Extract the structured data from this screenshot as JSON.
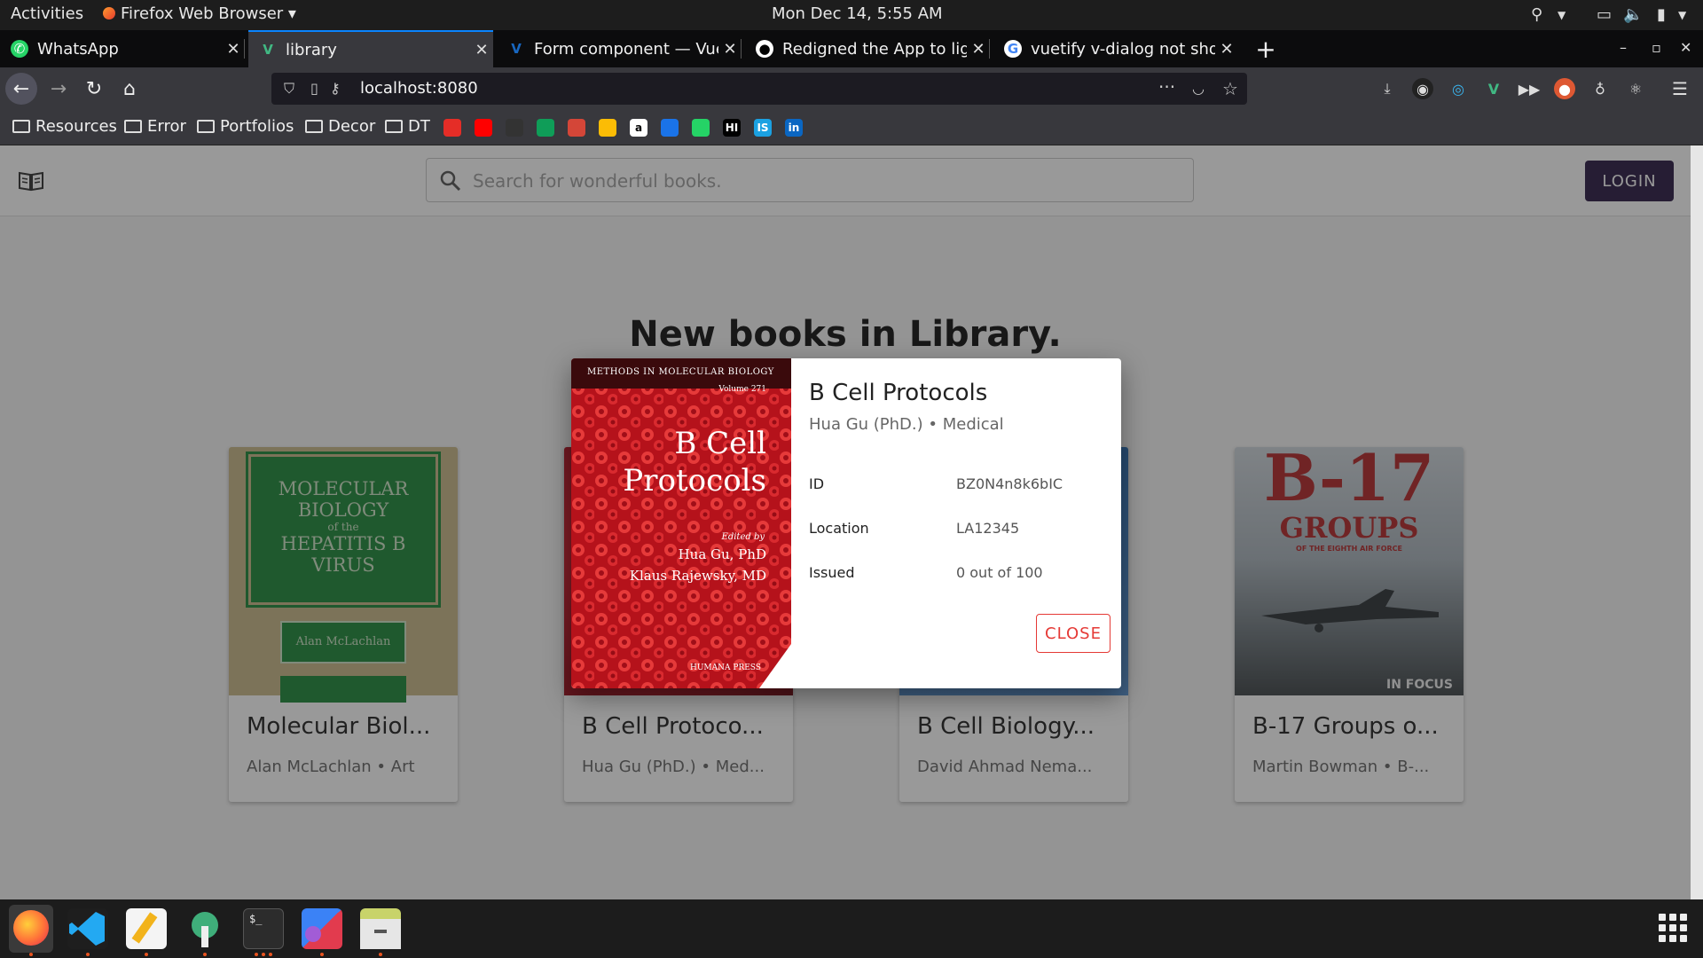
{
  "system": {
    "activities": "Activities",
    "app_menu": "Firefox Web Browser ▾",
    "clock": "Mon Dec 14,  5:55 AM"
  },
  "tabs": [
    {
      "title": "WhatsApp",
      "icon": "whatsapp-icon"
    },
    {
      "title": "library",
      "icon": "vue-icon",
      "active": true
    },
    {
      "title": "Form component — Vuetify",
      "icon": "vuetify-icon"
    },
    {
      "title": "Redigned the App to light",
      "icon": "github-icon"
    },
    {
      "title": "vuetify v-dialog not showing",
      "icon": "google-icon"
    }
  ],
  "urlbar": {
    "url": "localhost:8080"
  },
  "bookmarks": [
    {
      "label": "Resources"
    },
    {
      "label": "Error"
    },
    {
      "label": "Portfolios"
    },
    {
      "label": "Decor"
    },
    {
      "label": "DT"
    }
  ],
  "bookmark_icons": [
    {
      "label": "",
      "icon": "youtube-music-icon",
      "color": "#e52d27"
    },
    {
      "label": "",
      "icon": "youtube-icon",
      "color": "#ff0000"
    },
    {
      "label": "",
      "icon": "github-icon",
      "color": "#333333"
    },
    {
      "label": "",
      "icon": "hangouts-icon",
      "color": "#0f9d58"
    },
    {
      "label": "",
      "icon": "gmail-icon",
      "color": "#d44638"
    },
    {
      "label": "",
      "icon": "drive-icon",
      "color": "#fbbc05"
    },
    {
      "label": "a",
      "icon": "amazon-icon",
      "color": "#ffffff"
    },
    {
      "label": "",
      "icon": "media-icon",
      "color": "#1a73e8"
    },
    {
      "label": "",
      "icon": "whatsapp-icon",
      "color": "#25d366"
    },
    {
      "label": "HI",
      "icon": "hackerrank-icon",
      "color": "#000000"
    },
    {
      "label": "IS",
      "icon": "is-icon",
      "color": "#1ba1e2"
    },
    {
      "label": "in",
      "icon": "linkedin-icon",
      "color": "#0a66c2"
    }
  ],
  "app": {
    "search_placeholder": "Search for wonderful books.",
    "login_label": "LOGIN",
    "headline": "New books in Library."
  },
  "books": [
    {
      "title": "Molecular Biol...",
      "subtitle": "Alan McLachlan • Art",
      "cover_text": [
        "MOLECULAR",
        "BIOLOGY",
        "of the",
        "HEPATITIS B",
        "VIRUS",
        "Alan McLachlan"
      ]
    },
    {
      "title": "B Cell Protoco...",
      "subtitle": "Hua Gu (PhD.) • Med..."
    },
    {
      "title": "B Cell Biology...",
      "subtitle": "David Ahmad Nema..."
    },
    {
      "title": "B-17 Groups o...",
      "subtitle": "Martin Bowman • B-...",
      "cover_text": [
        "B-17",
        "GROUPS",
        "OF THE EIGHTH AIR FORCE",
        "IN FOCUS"
      ]
    }
  ],
  "dialog": {
    "title": "B Cell Protocols",
    "subtitle": "Hua Gu (PhD.) • Medical",
    "fields": [
      {
        "label": "ID",
        "value": "BZ0N4n8k6bIC"
      },
      {
        "label": "Location",
        "value": "LA12345"
      },
      {
        "label": "Issued",
        "value": "0 out of 100"
      }
    ],
    "close_label": "CLOSE",
    "cover_text": [
      "METHODS IN MOLECULAR BIOLOGY",
      "Volume 271",
      "B Cell",
      "Protocols",
      "Edited by",
      "Hua Gu, PhD",
      "Klaus Rajewsky, MD",
      "HUMANA PRESS"
    ]
  }
}
